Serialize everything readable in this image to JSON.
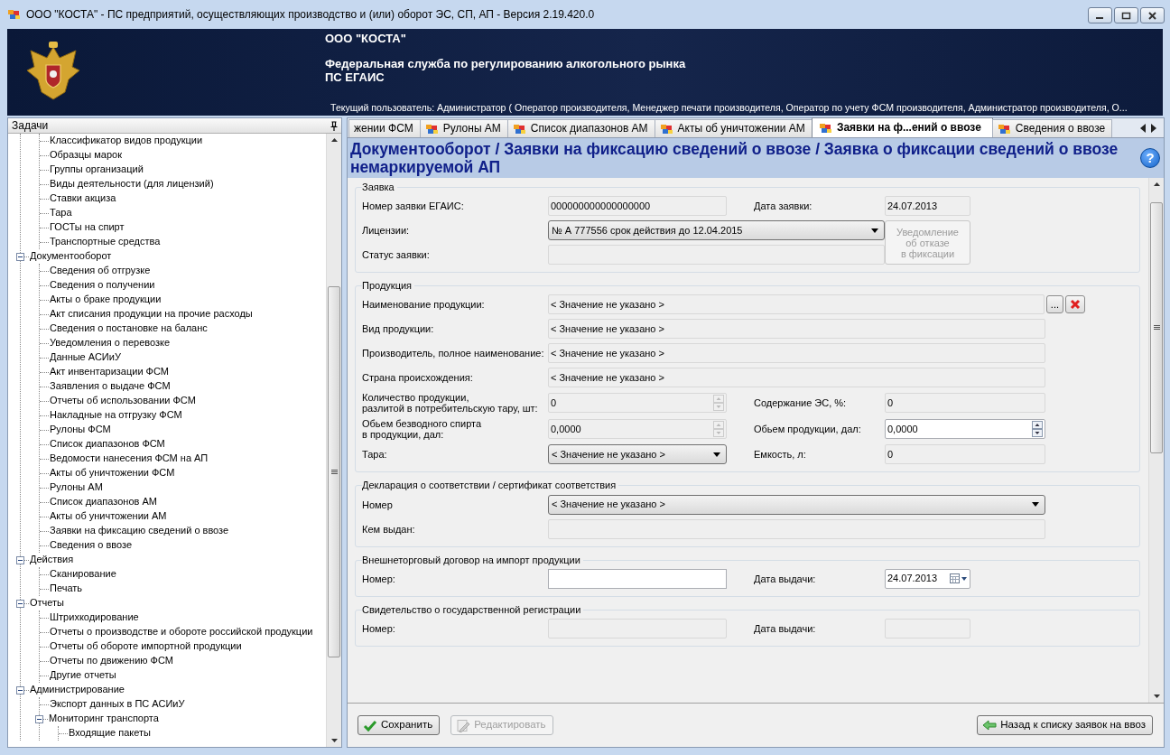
{
  "window": {
    "title": "ООО \"КОСТА\" - ПС предприятий, осуществляющих производство и (или) оборот ЭС, СП, АП - Версия 2.19.420.0"
  },
  "header": {
    "organization": "ООО \"КОСТА\"",
    "service": "Федеральная служба по регулированию алкогольного рынка",
    "system": "ПС ЕГАИС",
    "current_user": "Текущий пользователь: Администратор ( Оператор производителя, Менеджер печати производителя, Оператор по учету ФСМ производителя, Администратор производителя, О..."
  },
  "tasks_panel": {
    "title": "Задачи",
    "tree": [
      {
        "children": [
          {
            "label": "Классификатор видов продукции"
          },
          {
            "label": "Образцы марок"
          },
          {
            "label": "Группы организаций"
          },
          {
            "label": "Виды деятельности (для лицензий)"
          },
          {
            "label": "Ставки акциза"
          },
          {
            "label": "Тара"
          },
          {
            "label": "ГОСТы на спирт"
          },
          {
            "label": "Транспортные средства"
          }
        ]
      },
      {
        "label": "Документооборот",
        "expanded": true,
        "children": [
          {
            "label": "Сведения об отгрузке"
          },
          {
            "label": "Сведения о получении"
          },
          {
            "label": "Акты о браке продукции"
          },
          {
            "label": "Акт списания продукции на прочие расходы"
          },
          {
            "label": "Сведения о постановке на баланс"
          },
          {
            "label": "Уведомления о перевозке"
          },
          {
            "label": "Данные АСИиУ"
          },
          {
            "label": "Акт инвентаризации ФСМ"
          },
          {
            "label": "Заявления о выдаче ФСМ"
          },
          {
            "label": "Отчеты об использовании ФСМ"
          },
          {
            "label": "Накладные на отгрузку ФСМ"
          },
          {
            "label": "Рулоны ФСМ"
          },
          {
            "label": "Список диапазонов ФСМ"
          },
          {
            "label": "Ведомости нанесения ФСМ на АП"
          },
          {
            "label": "Акты об уничтожении ФСМ"
          },
          {
            "label": "Рулоны АМ"
          },
          {
            "label": "Список диапазонов АМ"
          },
          {
            "label": "Акты об уничтожении АМ"
          },
          {
            "label": "Заявки на фиксацию сведений о ввозе"
          },
          {
            "label": "Сведения о ввозе"
          }
        ]
      },
      {
        "label": "Действия",
        "expanded": true,
        "children": [
          {
            "label": "Сканирование"
          },
          {
            "label": "Печать"
          }
        ]
      },
      {
        "label": "Отчеты",
        "expanded": true,
        "children": [
          {
            "label": "Штрихкодирование"
          },
          {
            "label": "Отчеты о производстве и обороте российской продукции"
          },
          {
            "label": "Отчеты об обороте импортной продукции"
          },
          {
            "label": "Отчеты по движению ФСМ"
          },
          {
            "label": "Другие отчеты"
          }
        ]
      },
      {
        "label": "Администрирование",
        "expanded": true,
        "children": [
          {
            "label": "Экспорт данных в ПС АСИиУ"
          },
          {
            "label": "Мониторинг транспорта",
            "expanded": true,
            "children": [
              {
                "label": "Входящие пакеты"
              }
            ]
          }
        ]
      }
    ]
  },
  "tabs": [
    {
      "label": "жении ФСМ",
      "clipped": true,
      "selected": false
    },
    {
      "label": "Рулоны АМ",
      "clipped": false,
      "selected": false
    },
    {
      "label": "Список диапазонов АМ",
      "clipped": false,
      "selected": false
    },
    {
      "label": "Акты об уничтожении АМ",
      "clipped": false,
      "selected": false
    },
    {
      "label": "Заявки на ф...ений о ввозе",
      "clipped": false,
      "selected": true
    },
    {
      "label": "Сведения о ввозе",
      "clipped": false,
      "selected": false
    }
  ],
  "page": {
    "breadcrumb": "Документооборот / Заявки на фиксацию сведений о ввозе / Заявка о фиксации сведений о ввозе немаркируемой АП",
    "help": "?"
  },
  "groups": [
    {
      "title": "Заявка",
      "fields": [
        {
          "label": "Номер заявки ЕГАИС:",
          "kind": "text",
          "value": "000000000000000000"
        },
        {
          "label": "Дата заявки:",
          "kind": "date_text",
          "value": "24.07.2013"
        },
        {
          "label": "Лицензии:",
          "kind": "combo",
          "value": "№ А 777556 срок действия до 12.04.2015"
        },
        {
          "label": "Статус заявки:",
          "kind": "text"
        },
        {
          "label": "Уведомление\nоб отказе\nв фиксации",
          "kind": "button",
          "disabled": true
        }
      ]
    },
    {
      "title": "Продукция",
      "fields": [
        {
          "label": "Наименование продукции:",
          "kind": "lookup",
          "value": "< Значение не указано >",
          "button_label": "..."
        },
        {
          "label": "Вид продукции:",
          "kind": "text",
          "value": "< Значение не указано >"
        },
        {
          "label": "Производитель, полное наименование:",
          "kind": "text",
          "value": "< Значение не указано >"
        },
        {
          "label": "Страна происхождения:",
          "kind": "text",
          "value": "< Значение не указано >"
        },
        {
          "label": "Количество продукции,\nразлитой в потребительскую тару, шт:",
          "kind": "spin",
          "value": "0",
          "disabled": true
        },
        {
          "label": "Содержание ЭС, %:",
          "kind": "text",
          "value": "0"
        },
        {
          "label": "Обьем безводного спирта\nв продукции, дал:",
          "kind": "spin",
          "value": "0,0000",
          "disabled": true
        },
        {
          "label": "Обьем продукции, дал:",
          "kind": "spin",
          "value": "0,0000",
          "disabled": false
        },
        {
          "label": "Тара:",
          "kind": "combo",
          "value": "< Значение не указано >"
        },
        {
          "label": "Емкость, л:",
          "kind": "text",
          "value": "0"
        }
      ]
    },
    {
      "title": "Декларация о соответствии / сертификат соответствия",
      "fields": [
        {
          "label": "Номер",
          "kind": "combo",
          "value": "< Значение не указано >"
        },
        {
          "label": "Кем выдан:",
          "kind": "text"
        }
      ]
    },
    {
      "title": "Внешнеторговый договор на импорт продукции",
      "fields": [
        {
          "label": "Номер:",
          "kind": "input"
        },
        {
          "label": "Дата выдачи:",
          "kind": "date",
          "value": "24.07.2013"
        }
      ]
    },
    {
      "title": "Свидетельство о государственной регистрации",
      "fields": [
        {
          "label": "Номер:",
          "kind": "text"
        },
        {
          "label": "Дата выдачи:",
          "kind": "date_text"
        }
      ]
    }
  ],
  "footer": {
    "buttons": [
      {
        "label": "Сохранить",
        "kind": "save",
        "disabled": false
      },
      {
        "label": "Редактировать",
        "kind": "edit",
        "disabled": true
      },
      {
        "label": "Назад к списку заявок на ввоз",
        "kind": "back",
        "disabled": false
      }
    ]
  }
}
